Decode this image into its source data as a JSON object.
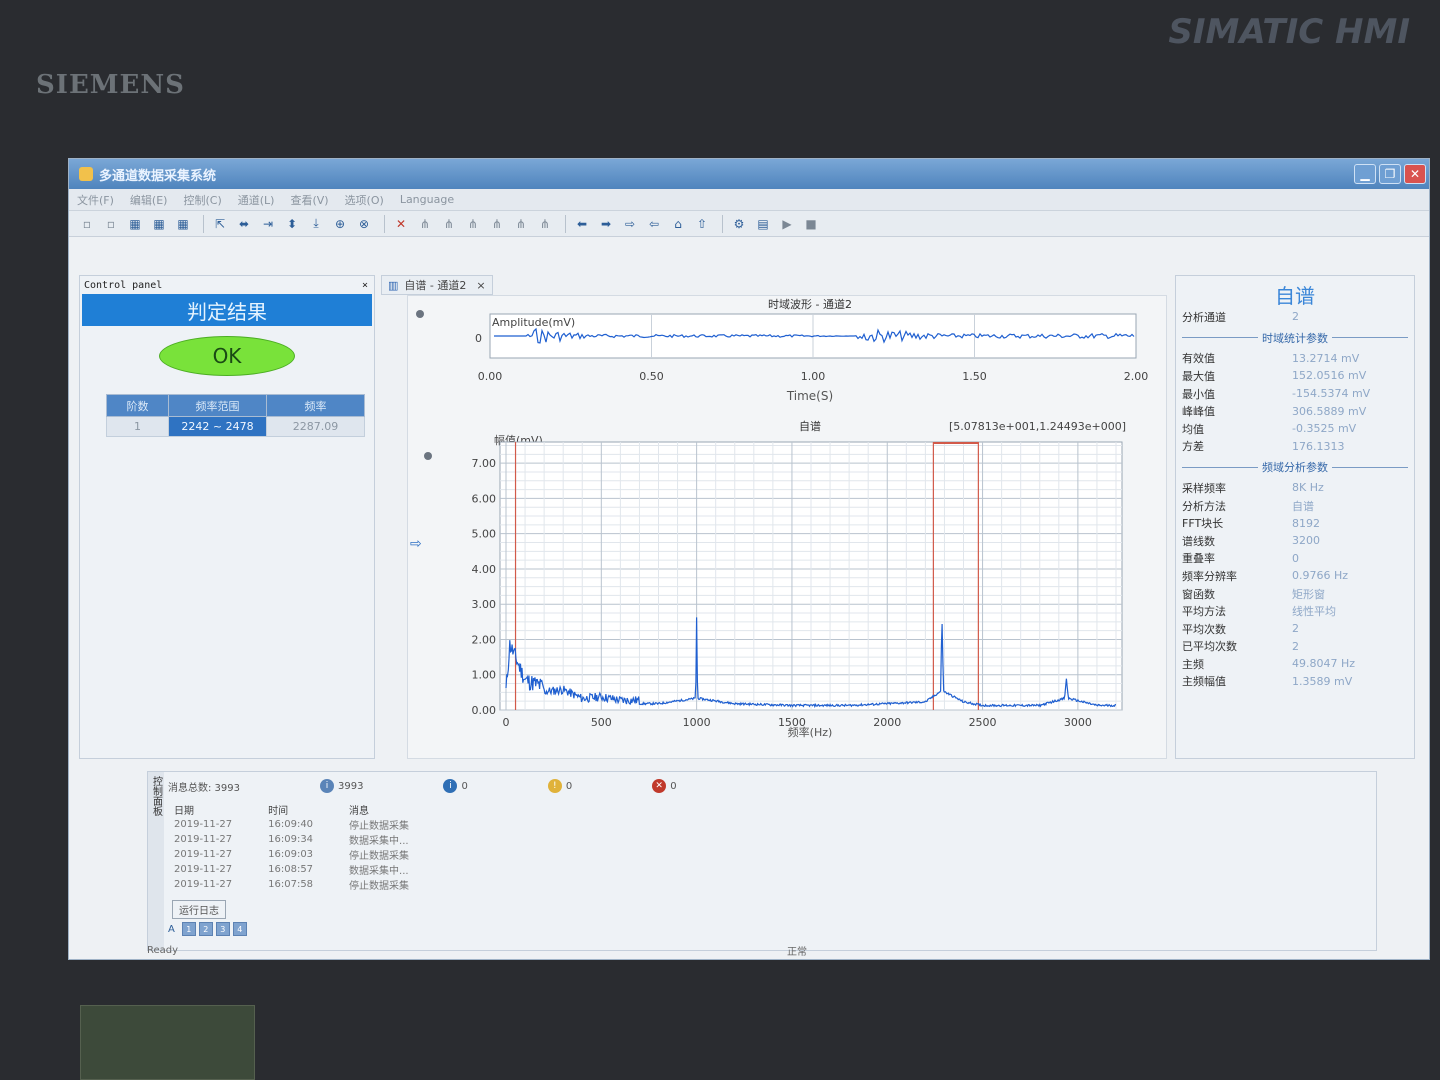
{
  "bezel": {
    "brand": "SIEMENS",
    "model": "SIMATIC HMI"
  },
  "app": {
    "title": "多通道数据采集系统",
    "menu": [
      "文件(F)",
      "编辑(E)",
      "控制(C)",
      "通道(L)",
      "查看(V)",
      "选项(O)",
      "Language"
    ]
  },
  "control_panel": {
    "title": "Control panel",
    "close": "×",
    "judge_label": "判定结果",
    "result": "OK",
    "table": {
      "headers": [
        "阶数",
        "频率范围",
        "频率"
      ],
      "rows": [
        [
          "1",
          "2242 ~ 2478",
          "2287.09"
        ]
      ]
    }
  },
  "tab": {
    "label": "自谱 - 通道2",
    "close": "×"
  },
  "time_chart": {
    "title": "时域波形 - 通道2",
    "ylabel": "Amplitude(mV)",
    "xlabel": "Time(S)",
    "xticks": [
      "0.00",
      "0.50",
      "1.00",
      "1.50",
      "2.00"
    ],
    "yticks": [
      "0"
    ]
  },
  "spec_chart": {
    "title": "自谱",
    "ylabel": "幅值(mV)",
    "xlabel": "频率(Hz)",
    "cursor_readout": "[5.07813e+001,1.24493e+000]",
    "xticks": [
      "0",
      "500",
      "1000",
      "1500",
      "2000",
      "2500",
      "3000"
    ],
    "yticks": [
      "0.00",
      "1.00",
      "2.00",
      "3.00",
      "4.00",
      "5.00",
      "6.00",
      "7.00"
    ]
  },
  "chart_data": [
    {
      "type": "line",
      "title": "时域波形 - 通道2",
      "xlabel": "Time(S)",
      "ylabel": "Amplitude(mV)",
      "xlim": [
        0,
        2.0
      ],
      "series": [
        {
          "x": [
            0.0,
            0.1,
            0.12,
            0.3,
            0.6,
            0.9,
            1.12,
            1.14,
            1.4,
            1.7,
            2.0
          ],
          "y": [
            0,
            0,
            18,
            4,
            3,
            3,
            0,
            17,
            5,
            5,
            6
          ]
        }
      ]
    },
    {
      "type": "line",
      "title": "自谱",
      "xlabel": "频率(Hz)",
      "ylabel": "幅值(mV)",
      "xlim": [
        0,
        3200
      ],
      "ylim": [
        0,
        7.6
      ],
      "series": [
        {
          "x": [
            0,
            20,
            50,
            100,
            200,
            300,
            400,
            500,
            600,
            800,
            995,
            1000,
            1005,
            1200,
            1500,
            1800,
            2200,
            2280,
            2287,
            2295,
            2400,
            2500,
            2800,
            2930,
            2940,
            2950,
            3100,
            3200
          ],
          "y": [
            0.3,
            1.6,
            1.24,
            0.6,
            0.4,
            0.45,
            0.2,
            0.25,
            0.15,
            0.15,
            0.3,
            2.6,
            0.3,
            0.15,
            0.1,
            0.1,
            0.2,
            0.5,
            2.7,
            0.5,
            0.2,
            0.1,
            0.1,
            0.3,
            0.85,
            0.3,
            0.1,
            0.1
          ]
        }
      ]
    }
  ],
  "stats": {
    "title": "自谱",
    "channel_label": "分析通道",
    "channel_value": "2",
    "time_section": "时域统计参数",
    "time_stats": [
      [
        "有效值",
        "13.2714 mV"
      ],
      [
        "最大值",
        "152.0516 mV"
      ],
      [
        "最小值",
        "-154.5374 mV"
      ],
      [
        "峰峰值",
        "306.5889 mV"
      ],
      [
        "均值",
        "-0.3525 mV"
      ],
      [
        "方差",
        "176.1313"
      ]
    ],
    "freq_section": "频域分析参数",
    "freq_stats": [
      [
        "采样频率",
        "8K Hz"
      ],
      [
        "分析方法",
        "自谱"
      ],
      [
        "FFT块长",
        "8192"
      ],
      [
        "谱线数",
        "3200"
      ],
      [
        "重叠率",
        "0"
      ],
      [
        "频率分辨率",
        "0.9766 Hz"
      ],
      [
        "窗函数",
        "矩形窗"
      ],
      [
        "平均方法",
        "线性平均"
      ],
      [
        "平均次数",
        "2"
      ],
      [
        "已平均次数",
        "2"
      ],
      [
        "主频",
        "49.8047 Hz"
      ],
      [
        "主频幅值",
        "1.3589 mV"
      ]
    ]
  },
  "log": {
    "side_label": "控制面板",
    "count_label": "消息总数: 3993",
    "info_count": "3993",
    "msg_count": "0",
    "warn_count": "0",
    "err_count": "0",
    "headers": [
      "日期",
      "时间",
      "消息"
    ],
    "rows": [
      [
        "2019-11-27",
        "16:09:40",
        "停止数据采集"
      ],
      [
        "2019-11-27",
        "16:09:34",
        "数据采集中..."
      ],
      [
        "2019-11-27",
        "16:09:03",
        "停止数据采集"
      ],
      [
        "2019-11-27",
        "16:08:57",
        "数据采集中..."
      ],
      [
        "2019-11-27",
        "16:07:58",
        "停止数据采集"
      ]
    ],
    "footer_tab": "运行日志",
    "pages": [
      "1",
      "2",
      "3",
      "4"
    ],
    "font_btn": "A"
  },
  "status": {
    "left": "Ready",
    "center": "正常"
  },
  "colors": {
    "trace": "#1f5fd0",
    "accent": "#1f7fd6",
    "ok": "#79e23a",
    "cursor": "#d25a4a"
  }
}
